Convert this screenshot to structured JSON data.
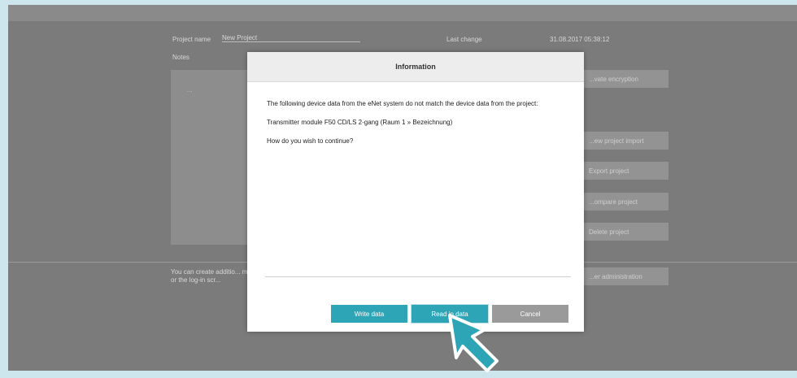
{
  "project": {
    "name_label": "Project name",
    "name_value": "New Project",
    "last_change_label": "Last change",
    "last_change_value": "31.08.2017 05:38:12",
    "notes_label": "Notes",
    "notes_value": "..."
  },
  "side_buttons": {
    "encryption": "...vate encryption",
    "import": "...ew project import",
    "export": "Export project",
    "compare": "...ompare project",
    "delete": "Delete project",
    "user_admin": "...er administration"
  },
  "info_text": "You can create additio... menu or the log-in scr...",
  "dialog": {
    "title": "Information",
    "message": "The following device data from the eNet system do not match the device data from the project:",
    "device": "Transmitter module F50 CD/LS 2-gang (Raum 1 » Bezeichnung)",
    "question": "How do you wish to continue?",
    "write_label": "Write data",
    "read_label": "Read in data",
    "cancel_label": "Cancel"
  },
  "colors": {
    "accent": "#2ea5b6",
    "cancel": "#9a9a9a",
    "cursor": "#2ea5b6"
  },
  "cursor_icon": "pointer-arrow-icon"
}
